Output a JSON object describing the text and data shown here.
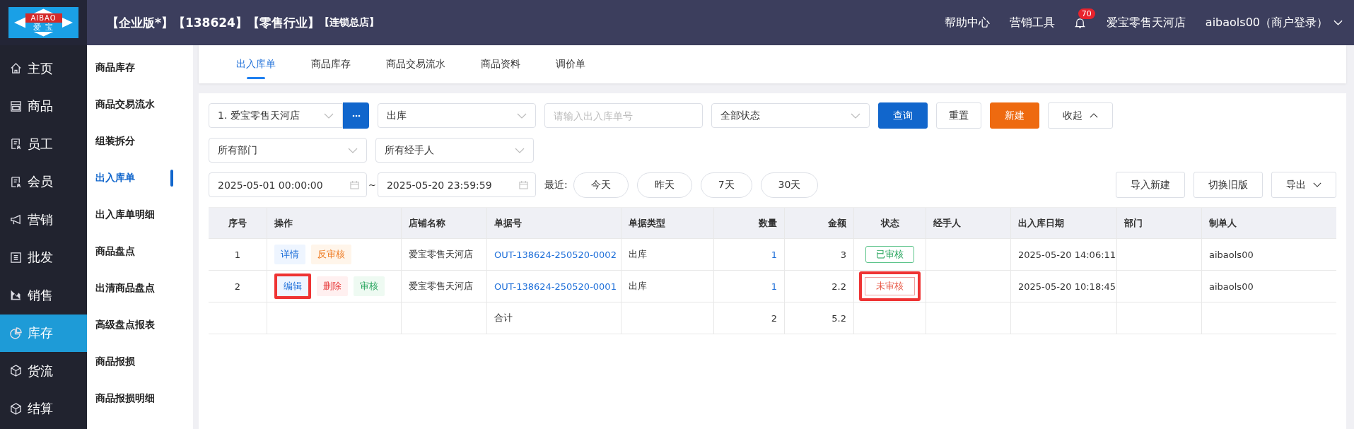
{
  "header": {
    "logo_top": "AIBAO",
    "logo_bottom": "爱 宝",
    "edition": "【企业版*】【138624】【零售行业】",
    "edition_tag": "【连锁总店】",
    "links": [
      "帮助中心",
      "营销工具"
    ],
    "notifications": "70",
    "store": "爱宝零售天河店",
    "user": "aibaols00（商户登录）"
  },
  "nav": [
    {
      "label": "主页",
      "selected": false
    },
    {
      "label": "商品",
      "selected": false
    },
    {
      "label": "员工",
      "selected": false
    },
    {
      "label": "会员",
      "selected": false
    },
    {
      "label": "营销",
      "selected": false
    },
    {
      "label": "批发",
      "selected": false
    },
    {
      "label": "销售",
      "selected": false
    },
    {
      "label": "库存",
      "selected": true
    },
    {
      "label": "货流",
      "selected": false
    },
    {
      "label": "结算",
      "selected": false
    }
  ],
  "subnav": [
    {
      "label": "商品库存",
      "selected": false
    },
    {
      "label": "商品交易流水",
      "selected": false
    },
    {
      "label": "组装拆分",
      "selected": false
    },
    {
      "label": "出入库单",
      "selected": true
    },
    {
      "label": "出入库单明细",
      "selected": false
    },
    {
      "label": "商品盘点",
      "selected": false
    },
    {
      "label": "出清商品盘点",
      "selected": false
    },
    {
      "label": "高级盘点报表",
      "selected": false
    },
    {
      "label": "商品报损",
      "selected": false
    },
    {
      "label": "商品报损明细",
      "selected": false
    }
  ],
  "tabs": [
    {
      "label": "出入库单",
      "selected": true
    },
    {
      "label": "商品库存",
      "selected": false
    },
    {
      "label": "商品交易流水",
      "selected": false
    },
    {
      "label": "商品资料",
      "selected": false
    },
    {
      "label": "调价单",
      "selected": false
    }
  ],
  "filters": {
    "store": "1. 爱宝零售天河店",
    "type": "出库",
    "number_placeholder": "请输入出入库单号",
    "status": "全部状态",
    "search": "查询",
    "reset": "重置",
    "create": "新建",
    "collapse": "收起",
    "department": "所有部门",
    "handler": "所有经手人",
    "date_from": "2025-05-01 00:00:00",
    "date_sep": "~",
    "date_to": "2025-05-20 23:59:59",
    "recent_label": "最近:",
    "quick": [
      "今天",
      "昨天",
      "7天",
      "30天"
    ],
    "import": "导入新建",
    "switch": "切换旧版",
    "export": "导出"
  },
  "table": {
    "columns": [
      "序号",
      "操作",
      "店铺名称",
      "单据号",
      "单据类型",
      "数量",
      "金额",
      "状态",
      "经手人",
      "出入库日期",
      "部门",
      "制单人"
    ],
    "rows": [
      {
        "index": "1",
        "actions": [
          {
            "label": "详情",
            "kind": "detail",
            "highlighted": false
          },
          {
            "label": "反审核",
            "kind": "warn",
            "highlighted": false
          }
        ],
        "store": "爱宝零售天河店",
        "number": "OUT-138624-250520-0002",
        "type": "出库",
        "qty": "1",
        "amount": "3",
        "status": {
          "label": "已审核",
          "kind": "approved",
          "highlighted": false
        },
        "date": "2025-05-20 14:06:11",
        "creator": "aibaols00"
      },
      {
        "index": "2",
        "actions": [
          {
            "label": "编辑",
            "kind": "detail",
            "highlighted": true
          },
          {
            "label": "删除",
            "kind": "danger",
            "highlighted": false
          },
          {
            "label": "审核",
            "kind": "success",
            "highlighted": false
          }
        ],
        "store": "爱宝零售天河店",
        "number": "OUT-138624-250520-0001",
        "type": "出库",
        "qty": "1",
        "amount": "2.2",
        "status": {
          "label": "未审核",
          "kind": "pending",
          "highlighted": true
        },
        "date": "2025-05-20 10:18:45",
        "creator": "aibaols00"
      }
    ],
    "total": {
      "label": "合计",
      "qty": "2",
      "amount": "5.2"
    }
  }
}
